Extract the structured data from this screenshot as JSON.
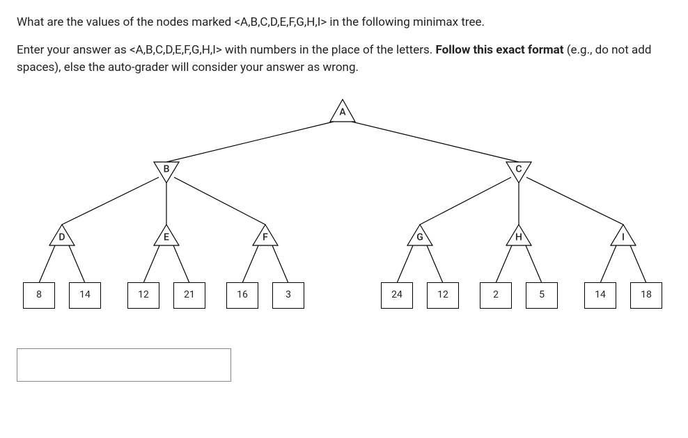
{
  "question": {
    "para1": "What are the values of the nodes marked <A,B,C,D,E,F,G,H,I> in the following minimax tree.",
    "para2_lead": "Enter your answer as <A,B,C,D,E,F,G,H,I> with numbers in the place of the letters. ",
    "para2_bold": "Follow this exact format",
    "para2_tail": " (e.g., do not add spaces), else the auto-grader will consider your answer as wrong."
  },
  "nodes": {
    "A": "A",
    "B": "B",
    "C": "C",
    "D": "D",
    "E": "E",
    "F": "F",
    "G": "G",
    "H": "H",
    "I": "I"
  },
  "leaves": {
    "l0": "8",
    "l1": "14",
    "l2": "12",
    "l3": "21",
    "l4": "16",
    "l5": "3",
    "l6": "24",
    "l7": "12",
    "l8": "2",
    "l9": "5",
    "l10": "14",
    "l11": "18"
  },
  "answer": {
    "value": ""
  }
}
